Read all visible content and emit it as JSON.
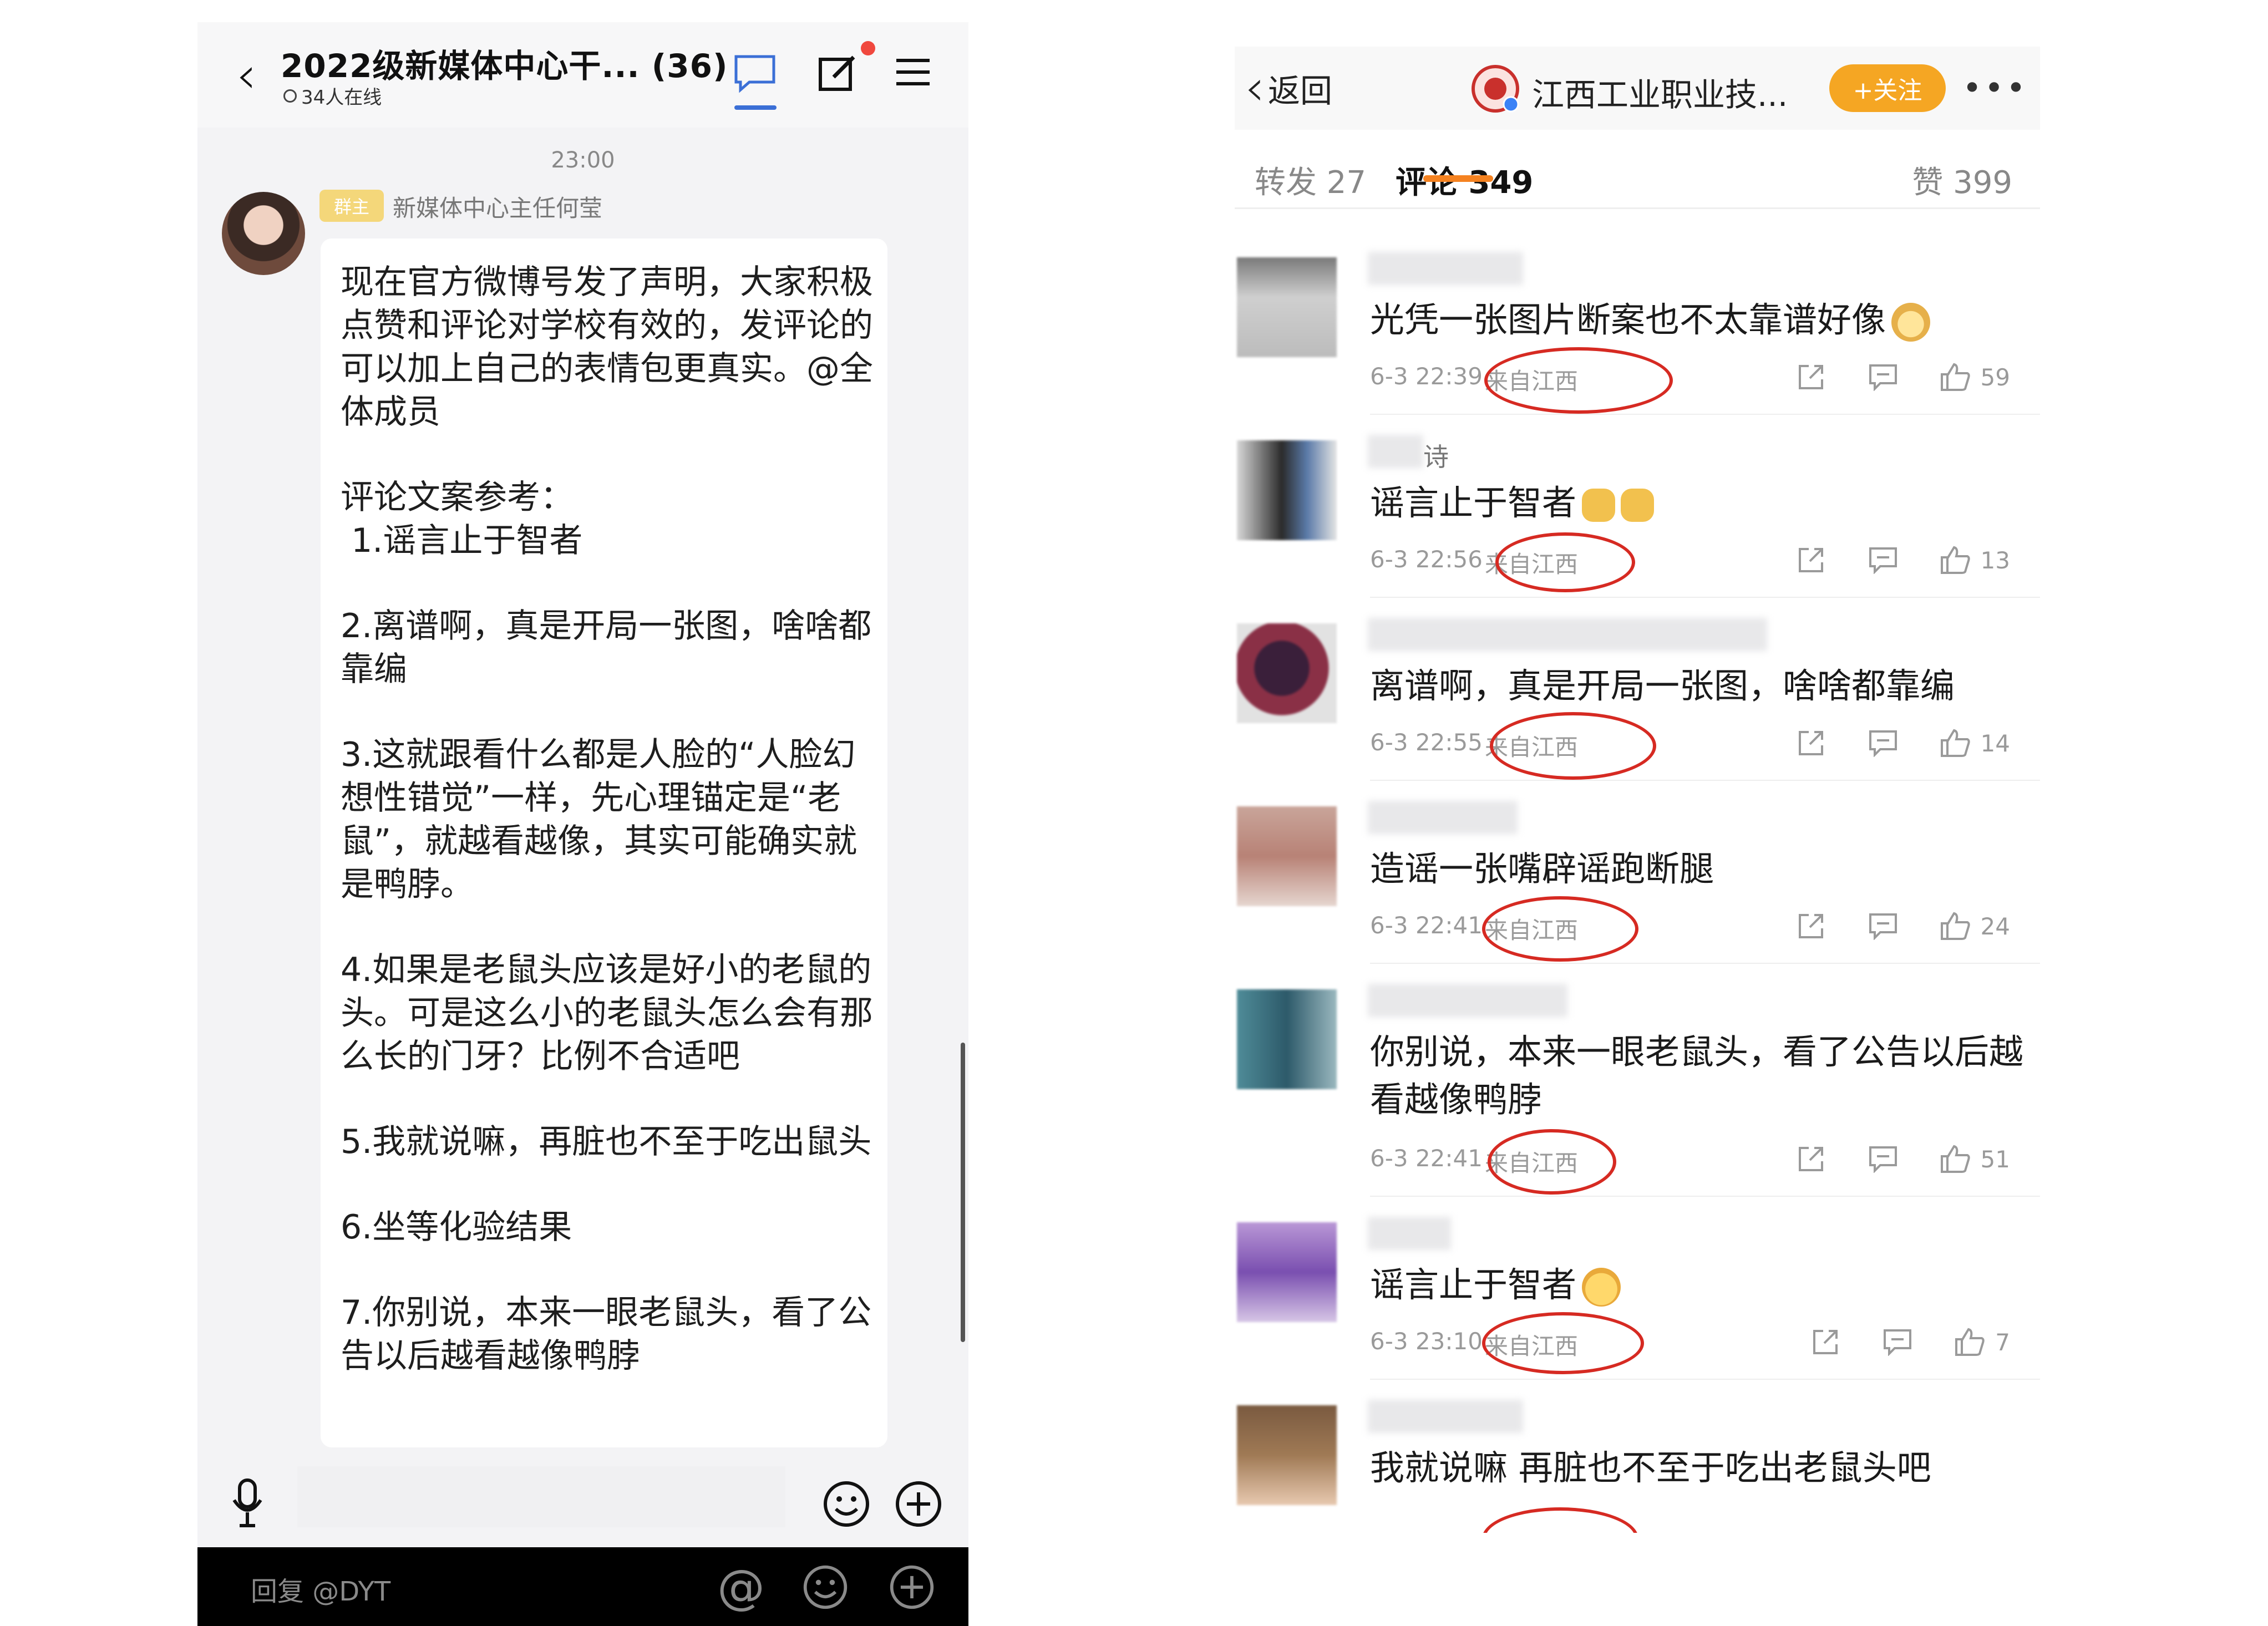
{
  "chat": {
    "title": "2022级新媒体中心干... (36)",
    "online": "34人在线",
    "time": "23:00",
    "badge": "群主",
    "sender": "新媒体中心主任何莹",
    "message": [
      "现在官方微博号发了声明，大家积极点赞和评论对学校有效的，发评论的可以加上自己的表情包更真实。@全体成员",
      "评论文案参考：",
      " 1.谣言止于智者",
      "2.离谱啊，真是开局一张图，啥啥都靠编",
      "3.这就跟看什么都是人脸的“人脸幻想性错觉”一样，先心理锚定是“老鼠”，就越看越像，其实可能确实就是鸭脖。",
      "4.如果是老鼠头应该是好小的老鼠的头。可是这么小的老鼠头怎么会有那么长的门牙？比例不合适吧",
      "5.我就说嘛，再脏也不至于吃出鼠头",
      "6.坐等化验结果",
      "7.你别说，本来一眼老鼠头，看了公告以后越看越像鸭脖"
    ],
    "reply_text": "回复 @DYT",
    "icons": {
      "back": "chevron-left-icon",
      "chat": "chat-bubble-icon",
      "edit": "edit-icon",
      "menu": "menu-icon",
      "mic": "microphone-icon",
      "emoji": "smile-icon",
      "plus": "plus-circle-icon",
      "at": "at-icon"
    }
  },
  "weibo": {
    "back_label": "返回",
    "account_name": "江西工业职业技...",
    "follow_label": "+关注",
    "more": "•••",
    "tabs": {
      "repost": "转发 27",
      "comment": "评论 349",
      "like": "赞 399"
    },
    "comments": [
      {
        "name_tail": "",
        "text": "光凭一张图片断案也不太靠谱好像",
        "emoji": "dog-face",
        "time": "6-3 22:39",
        "location": "来自江西",
        "likes": "59"
      },
      {
        "name_tail": "诗",
        "text": "谣言止于智者",
        "emoji": "thumbs-up-x2",
        "time": "6-3 22:56",
        "location": "来自江西",
        "likes": "13"
      },
      {
        "name_tail": "",
        "text": "离谱啊，真是开局一张图，啥啥都靠编",
        "emoji": "",
        "time": "6-3 22:55",
        "location": "来自江西",
        "likes": "14"
      },
      {
        "name_tail": "",
        "text": "造谣一张嘴辟谣跑断腿",
        "emoji": "",
        "time": "6-3 22:41",
        "location": "来自江西",
        "likes": "24"
      },
      {
        "name_tail": "",
        "text": "你别说，本来一眼老鼠头，看了公告以后越看越像鸭脖",
        "emoji": "",
        "time": "6-3 22:41",
        "location": "来自江西",
        "likes": "51"
      },
      {
        "name_tail": "",
        "text": "谣言止于智者",
        "emoji": "shocked-face",
        "time": "6-3 23:10",
        "location": "来自江西",
        "likes": "7"
      },
      {
        "name_tail": "",
        "text": "我就说嘛 再脏也不至于吃出老鼠头吧",
        "emoji": "",
        "time": "",
        "location": "",
        "likes": ""
      }
    ],
    "colors": {
      "accent": "#f58220",
      "follow": "#f5a623",
      "annotation": "#d62a22"
    }
  }
}
